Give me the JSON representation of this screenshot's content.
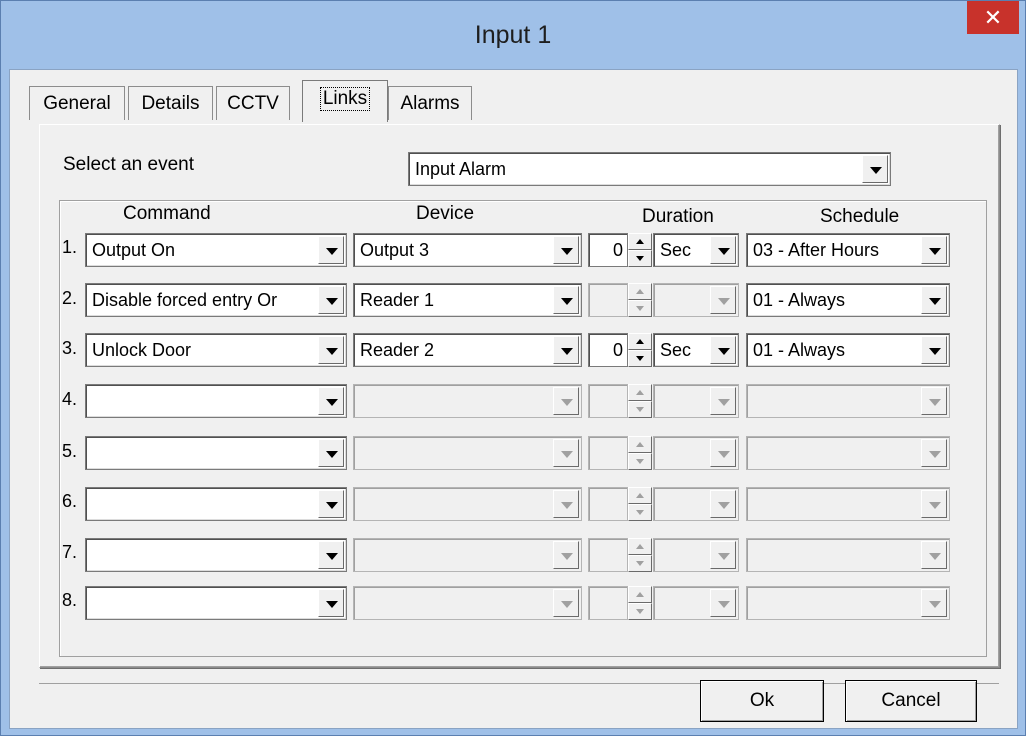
{
  "window": {
    "title": "Input 1",
    "close_glyph": "✕"
  },
  "tabs": [
    {
      "label": "General"
    },
    {
      "label": "Details"
    },
    {
      "label": "CCTV"
    },
    {
      "label": "Links"
    },
    {
      "label": "Alarms"
    }
  ],
  "event": {
    "label": "Select an event",
    "value": "Input Alarm"
  },
  "headers": {
    "command": "Command",
    "device": "Device",
    "duration": "Duration",
    "schedule": "Schedule"
  },
  "rows": [
    {
      "num": "1.",
      "command": "Output On",
      "device": "Output 3",
      "duration": "0",
      "unit": "Sec",
      "schedule": "03 - After Hours"
    },
    {
      "num": "2.",
      "command": "Disable forced entry Or",
      "device": "Reader 1",
      "duration": "",
      "unit": "",
      "schedule": "01 - Always"
    },
    {
      "num": "3.",
      "command": "Unlock Door",
      "device": "Reader 2",
      "duration": "0",
      "unit": "Sec",
      "schedule": "01 - Always"
    },
    {
      "num": "4.",
      "command": "",
      "device": "",
      "duration": "",
      "unit": "",
      "schedule": ""
    },
    {
      "num": "5.",
      "command": "",
      "device": "",
      "duration": "",
      "unit": "",
      "schedule": ""
    },
    {
      "num": "6.",
      "command": "",
      "device": "",
      "duration": "",
      "unit": "",
      "schedule": ""
    },
    {
      "num": "7.",
      "command": "",
      "device": "",
      "duration": "",
      "unit": "",
      "schedule": ""
    },
    {
      "num": "8.",
      "command": "",
      "device": "",
      "duration": "",
      "unit": "",
      "schedule": ""
    }
  ],
  "buttons": {
    "ok": "Ok",
    "cancel": "Cancel"
  }
}
